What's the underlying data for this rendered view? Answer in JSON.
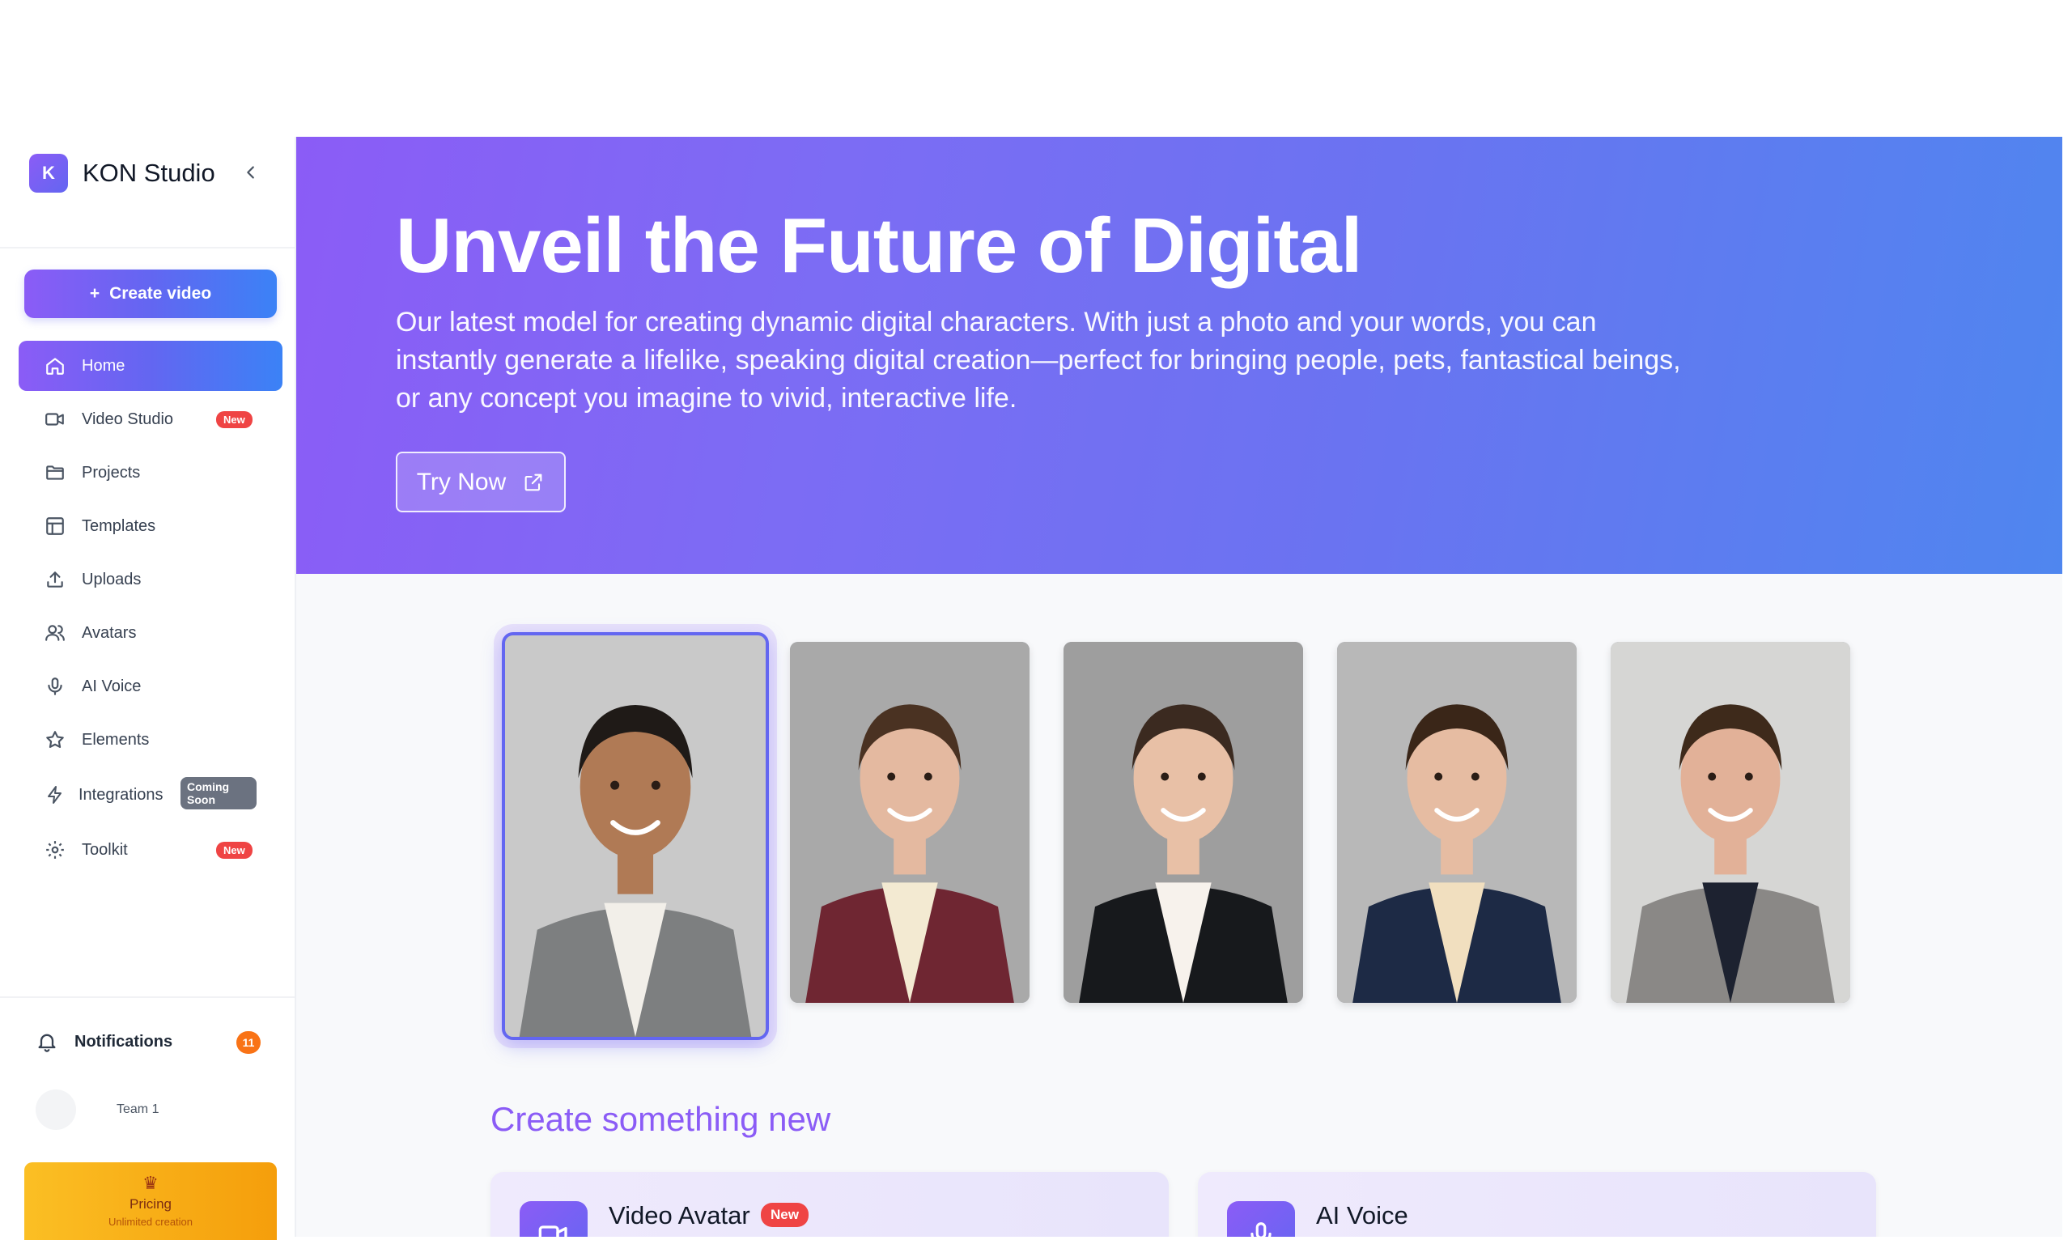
{
  "app": {
    "name": "KON Studio",
    "logo_letter": "K"
  },
  "sidebar": {
    "create_button": "Create video",
    "items": [
      {
        "label": "Home",
        "icon": "home-icon",
        "active": true
      },
      {
        "label": "Video Studio",
        "icon": "video-camera-icon",
        "badge": "New"
      },
      {
        "label": "Projects",
        "icon": "folder-icon"
      },
      {
        "label": "Templates",
        "icon": "layout-icon"
      },
      {
        "label": "Uploads",
        "icon": "upload-icon"
      },
      {
        "label": "Avatars",
        "icon": "users-icon"
      },
      {
        "label": "AI Voice",
        "icon": "microphone-icon"
      },
      {
        "label": "Elements",
        "icon": "star-icon"
      },
      {
        "label": "Integrations",
        "icon": "bolt-icon",
        "badge_line1": "Coming",
        "badge_line2": "Soon"
      },
      {
        "label": "Toolkit",
        "icon": "gear-icon",
        "badge": "New"
      }
    ],
    "notifications": {
      "label": "Notifications",
      "count": "11"
    },
    "team": {
      "name": "Team 1"
    },
    "pricing": {
      "label": "Pricing",
      "subtitle": "Unlimited creation",
      "icon": "trophy-icon"
    }
  },
  "hero": {
    "title": "Unveil the Future of Digital",
    "description": "Our latest model for creating dynamic digital characters. With just a photo and your words, you can instantly generate a lifelike, speaking digital creation—perfect for bringing people, pets, fantastical beings, or any concept you imagine to vivid, interactive life.",
    "cta": "Try Now"
  },
  "avatars": [
    {
      "selected": true,
      "bg": "#c9c9c9",
      "skin": "#b07a55",
      "hair": "#1f1a17",
      "jacket": "#7d7f80",
      "shirt": "#f2efe9"
    },
    {
      "selected": false,
      "bg": "#a9a9a9",
      "skin": "#e4b9a0",
      "hair": "#4a3222",
      "jacket": "#6f2632",
      "shirt": "#f3ead2"
    },
    {
      "selected": false,
      "bg": "#9e9e9e",
      "skin": "#e8c0a6",
      "hair": "#3b2a20",
      "jacket": "#17191c",
      "shirt": "#f7f2ec"
    },
    {
      "selected": false,
      "bg": "#b8b8b8",
      "skin": "#e6bca2",
      "hair": "#3a2618",
      "jacket": "#1d2a45",
      "shirt": "#f1dfbf"
    },
    {
      "selected": false,
      "bg": "#d6d6d4",
      "skin": "#e2b198",
      "hair": "#3e2a1b",
      "jacket": "#8a8886",
      "shirt": "#1d2230"
    }
  ],
  "create_section": {
    "title": "Create something new",
    "cards": [
      {
        "title": "Video Avatar",
        "badge": "New",
        "icon": "video-camera-icon"
      },
      {
        "title": "AI Voice",
        "icon": "microphone-icon"
      }
    ]
  },
  "colors": {
    "accent": "#8b5cf6",
    "accent_blue": "#6366f1",
    "badge_red": "#ef4444",
    "notify_orange": "#f97316",
    "pricing_yellow": "#fbbf24"
  }
}
